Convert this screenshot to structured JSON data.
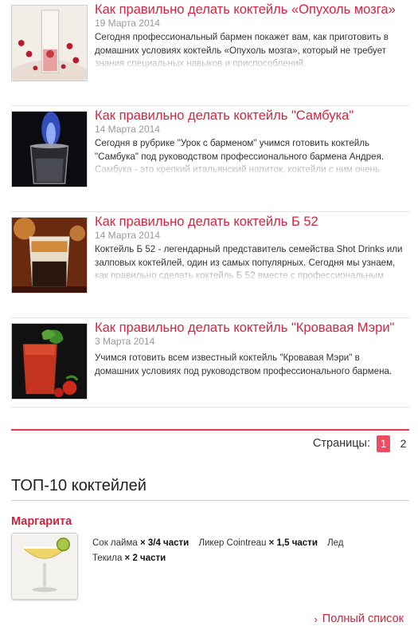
{
  "articles": [
    {
      "title": "Как правильно делать коктейль «Опухоль мозга»",
      "date": "19 Марта 2014",
      "excerpt": "Сегодня профессиональный бармен покажет вам, как приготовить в домашних условиях коктейль «Опухоль мозга», который не требует знания специальных навыков и приспособлений."
    },
    {
      "title": "Как правильно делать коктейль \"Самбука\"",
      "date": "14 Марта 2014",
      "excerpt": "Сегодня в рубрике \"Урок с барменом\" учимся готовить коктейль \"Самбука\" под руководством профессионального бармена Андрея. Самбука - это крепкий итальянский напиток, коктейли с ним очень"
    },
    {
      "title": "Как правильно делать коктейль Б 52",
      "date": "14 Марта 2014",
      "excerpt": "Коктейль Б 52 - легендарный представитель семейства Shot Drinks или залповых коктейлей, один из самых популярных. Сегодня мы узнаем, как правильно сделать коктейль Б 52 вместе с профессиональным"
    },
    {
      "title": "Как правильно делать коктейль \"Кровавая Мэри\"",
      "date": "3 Марта 2014",
      "excerpt": "Учимся готовить всем известный коктейль \"Кровавая Мэри\" в домашних условиях под руководством профессионального бармена."
    }
  ],
  "pagination": {
    "label": "Страницы:",
    "pages": [
      "1",
      "2"
    ],
    "active": "1"
  },
  "top10": {
    "title": "ТОП-10 коктейлей",
    "cocktail_name": "Маргарита",
    "ingredients": [
      {
        "name": "Сок лайма",
        "amount": "× 3/4 части"
      },
      {
        "name": "Ликер Cointreau",
        "amount": "× 1,5 части"
      },
      {
        "name": "Лед",
        "amount": ""
      },
      {
        "name": "Текила",
        "amount": "× 2 части"
      }
    ],
    "full_list_label": "Полный список",
    "full_list_icon": "chevron-right-icon"
  },
  "colors": {
    "accent": "#d9233f",
    "pager_active": "#ef4b63",
    "text": "#222222",
    "muted": "#999999"
  }
}
